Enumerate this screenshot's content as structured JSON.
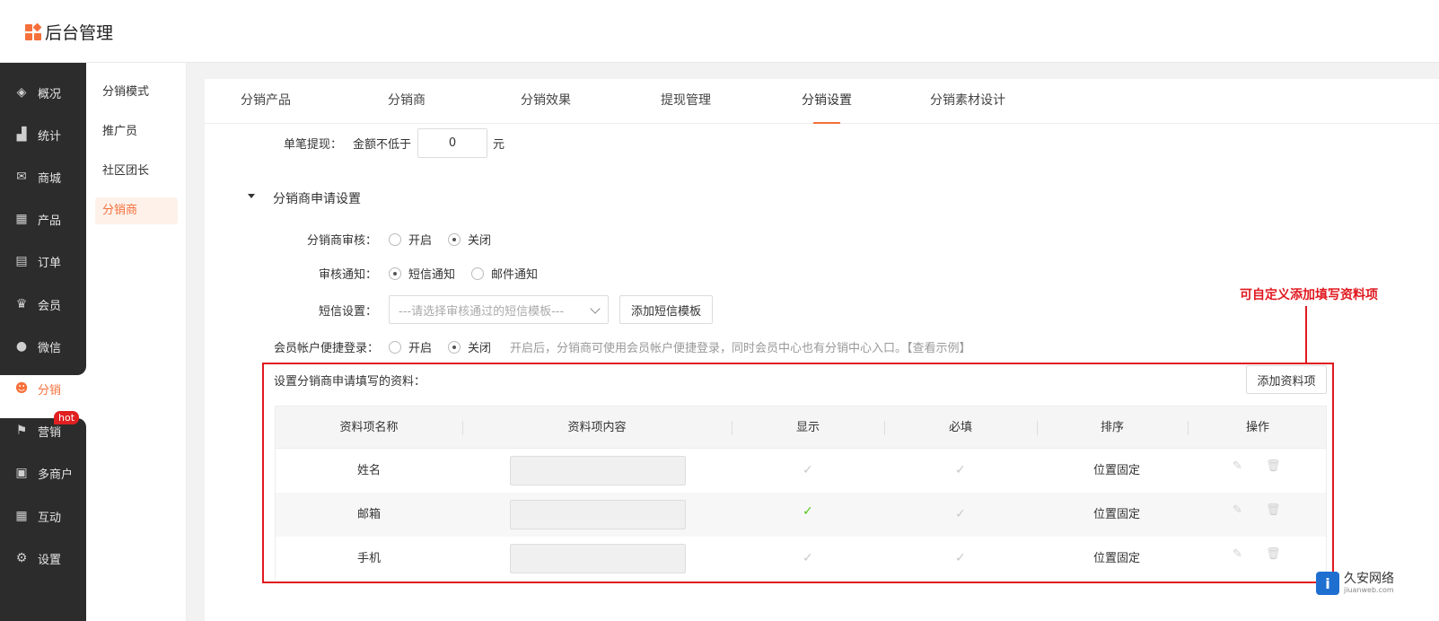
{
  "app": {
    "title": "后台管理"
  },
  "sidebar": {
    "items": [
      {
        "label": "概况",
        "icon": "layers-icon",
        "glyph": "◈"
      },
      {
        "label": "统计",
        "icon": "bar-chart-icon",
        "glyph": "▟"
      },
      {
        "label": "商城",
        "icon": "mail-icon",
        "glyph": "✉"
      },
      {
        "label": "产品",
        "icon": "grid-icon",
        "glyph": "▦"
      },
      {
        "label": "订单",
        "icon": "order-icon",
        "glyph": "▤"
      },
      {
        "label": "会员",
        "icon": "crown-icon",
        "glyph": "♛"
      },
      {
        "label": "微信",
        "icon": "chat-icon",
        "glyph": "●"
      },
      {
        "label": "分销",
        "icon": "users-icon",
        "glyph": "☻",
        "active": true
      },
      {
        "label": "营销",
        "icon": "flag-icon",
        "glyph": "⚑",
        "badge": "hot"
      },
      {
        "label": "多商户",
        "icon": "store-icon",
        "glyph": "▣"
      },
      {
        "label": "互动",
        "icon": "apps-icon",
        "glyph": "▦"
      },
      {
        "label": "设置",
        "icon": "gear-icon",
        "glyph": "⚙"
      }
    ]
  },
  "subnav": {
    "items": [
      {
        "label": "分销模式"
      },
      {
        "label": "推广员"
      },
      {
        "label": "社区团长"
      },
      {
        "label": "分销商",
        "active": true
      }
    ]
  },
  "tabs": [
    {
      "label": "分销产品"
    },
    {
      "label": "分销商"
    },
    {
      "label": "分销效果"
    },
    {
      "label": "提现管理"
    },
    {
      "label": "分销设置",
      "active": true
    },
    {
      "label": "分销素材设计"
    }
  ],
  "withdraw": {
    "label": "单笔提现：",
    "min_label": "金额不低于",
    "value": "0",
    "unit": "元"
  },
  "section": {
    "title": "分销商申请设置"
  },
  "form": {
    "review": {
      "label": "分销商审核：",
      "options": [
        "开启",
        "关闭"
      ],
      "selected": "关闭"
    },
    "notify": {
      "label": "审核通知：",
      "options": [
        "短信通知",
        "邮件通知"
      ],
      "selected": "短信通知"
    },
    "sms": {
      "label": "短信设置：",
      "placeholder": "---请选择审核通过的短信模板---",
      "add_button": "添加短信模板"
    },
    "quick_login": {
      "label": "会员帐户便捷登录：",
      "options": [
        "开启",
        "关闭"
      ],
      "selected": "关闭",
      "hint": "开启后，分销商可使用会员帐户便捷登录，同时会员中心也有分销中心入口。【查看示例】"
    }
  },
  "fields": {
    "title": "设置分销商申请填写的资料：",
    "add_button": "添加资料项",
    "columns": [
      "资料项名称",
      "资料项内容",
      "显示",
      "必填",
      "排序",
      "操作"
    ],
    "rows": [
      {
        "name": "姓名",
        "show_active": false,
        "required": true,
        "order": "位置固定"
      },
      {
        "name": "邮箱",
        "show_active": true,
        "required": true,
        "order": "位置固定"
      },
      {
        "name": "手机",
        "show_active": false,
        "required": true,
        "order": "位置固定"
      }
    ]
  },
  "annotation": {
    "text": "可自定义添加填写资料项",
    "color": "#e0191f"
  },
  "watermark": {
    "name": "久安网络",
    "url": "jiuanweb.com"
  },
  "colors": {
    "accent": "#f6703b",
    "sidebar": "#2c2c2c",
    "annotation": "#e0191f",
    "check_active": "#52c41a"
  }
}
